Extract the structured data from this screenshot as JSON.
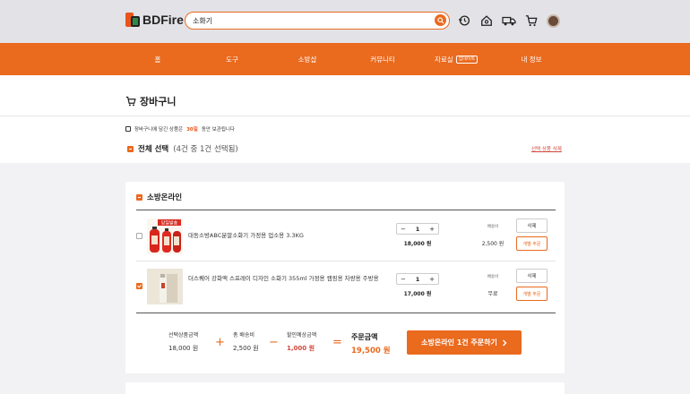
{
  "header": {
    "logo_text": "BDFire",
    "search_value": "소화기"
  },
  "nav": {
    "items": [
      {
        "label": "홈"
      },
      {
        "label": "도구"
      },
      {
        "label": "소방샵"
      },
      {
        "label": "커뮤니티"
      },
      {
        "label": "자료실",
        "badge": "업데이트"
      },
      {
        "label": "내 정보"
      }
    ]
  },
  "page": {
    "title": "장바구니",
    "notice_prefix": "장바구니에 담긴 상품은",
    "notice_days": "30일",
    "notice_suffix": "동안 보관됩니다",
    "select_all_label": "전체 선택",
    "select_all_count": "(4건 중 1건 선택됨)",
    "delete_selected": "선택 상품 삭제"
  },
  "shop": {
    "name": "소방온라인",
    "items": [
      {
        "name": "대동소방ABC분말소화기 가정용 업소용 3.3KG",
        "qty": "1",
        "price": "18,000 원",
        "shipping_label": "배송비",
        "shipping_value": "2,500 원",
        "delete_label": "삭제",
        "order_label": "개별 주문",
        "checked": false,
        "thumb_text": "당일발송"
      },
      {
        "name": "더스퀘어 강화액 스프레이 디자인 소화기 355ml 가정용 캠핑용 차량용 주방용",
        "qty": "1",
        "price": "17,000 원",
        "shipping_label": "배송비",
        "shipping_value": "무료",
        "delete_label": "삭제",
        "order_label": "개별 주문",
        "checked": true
      }
    ],
    "summary": {
      "product_label": "선택상품금액",
      "product_value": "18,000 원",
      "shipping_label": "총 배송비",
      "shipping_value": "2,500 원",
      "discount_label": "할인예상금액",
      "discount_value": "1,000 원",
      "total_label": "주문금액",
      "total_value": "19,500 원",
      "plus": "+",
      "minus": "−",
      "equals": "="
    },
    "order_button": "소방온라인 1건 주문하기"
  },
  "colors": {
    "accent": "#ea6a1e",
    "danger": "#d2483a"
  }
}
